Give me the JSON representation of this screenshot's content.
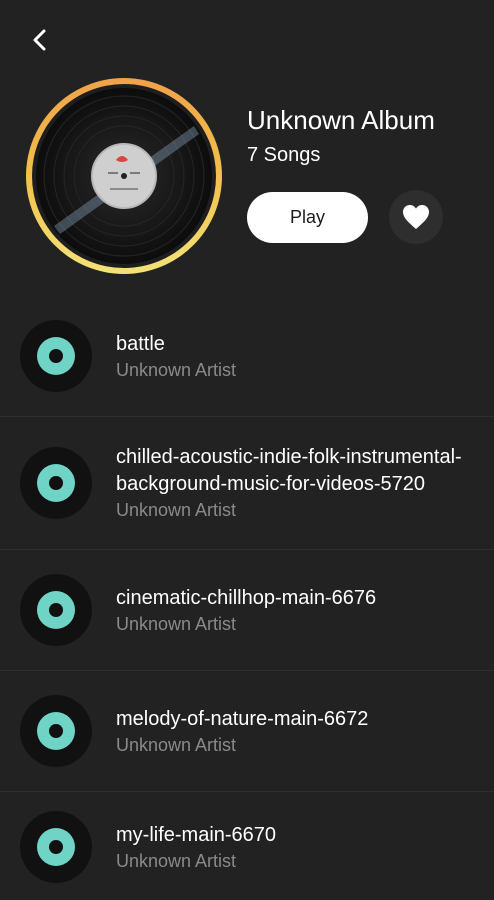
{
  "header": {
    "back_icon": "chevron-left-icon"
  },
  "album": {
    "title": "Unknown Album",
    "song_count": "7 Songs",
    "play_label": "Play",
    "like_icon": "heart-icon",
    "cover_icon": "vinyl-record-icon"
  },
  "songs": [
    {
      "title": "battle",
      "artist": "Unknown Artist"
    },
    {
      "title": "chilled-acoustic-indie-folk-instrumental-background-music-for-videos-5720",
      "artist": "Unknown Artist"
    },
    {
      "title": "cinematic-chillhop-main-6676",
      "artist": "Unknown Artist"
    },
    {
      "title": "melody-of-nature-main-6672",
      "artist": "Unknown Artist"
    },
    {
      "title": "my-life-main-6670",
      "artist": "Unknown Artist"
    }
  ],
  "colors": {
    "background": "#222222",
    "accent_teal": "#6fd3c6",
    "ring_gold": "#f2c94c",
    "muted_text": "#8a8a8a"
  }
}
